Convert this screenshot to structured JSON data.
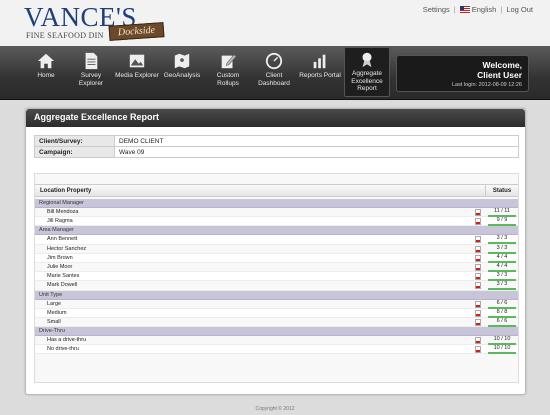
{
  "header": {
    "logo": {
      "main": "VANCE'S",
      "sub": "FINE SEAFOOD DIN",
      "badge": "Dockside"
    },
    "links": {
      "settings": "Settings",
      "language": "English",
      "logout": "Log Out"
    }
  },
  "nav": {
    "items": [
      {
        "label": "Home",
        "icon": "home-icon"
      },
      {
        "label": "Survey Explorer",
        "icon": "document-icon"
      },
      {
        "label": "Media Explorer",
        "icon": "image-icon"
      },
      {
        "label": "GeoAnalysis",
        "icon": "map-icon"
      },
      {
        "label": "Custom Rollups",
        "icon": "edit-icon"
      },
      {
        "label": "Client Dashboard",
        "icon": "gauge-icon"
      },
      {
        "label": "Reports Portal",
        "icon": "chart-icon"
      },
      {
        "label": "Aggregate Excellence Report",
        "icon": "award-icon"
      }
    ],
    "welcome": {
      "line1": "Welcome,",
      "line2": "Client User",
      "last_login": "Last login: 2012-08-09 12:26"
    }
  },
  "report": {
    "title": "Aggregate Excellence Report",
    "client_label": "Client/Survey:",
    "client_value": "DEMO CLIENT",
    "campaign_label": "Campaign:",
    "campaign_value": "Wave 09",
    "col_property": "Location Property",
    "col_status": "Status",
    "groups": [
      {
        "name": "Regional Manager",
        "rows": [
          {
            "name": "Bill Mendoza",
            "status": "11 / 11",
            "pct": 1
          },
          {
            "name": "Jill Ragma",
            "status": "9 / 9",
            "pct": 1
          }
        ]
      },
      {
        "name": "Area Manager",
        "rows": [
          {
            "name": "Ann Bennett",
            "status": "3 / 3",
            "pct": 1
          },
          {
            "name": "Hector Sanchez",
            "status": "3 / 3",
            "pct": 1
          },
          {
            "name": "Jim Brown",
            "status": "4 / 4",
            "pct": 1
          },
          {
            "name": "Julie Moor",
            "status": "4 / 4",
            "pct": 1
          },
          {
            "name": "Marie Santes",
            "status": "3 / 3",
            "pct": 1
          },
          {
            "name": "Mark Dowell",
            "status": "3 / 3",
            "pct": 1
          }
        ]
      },
      {
        "name": "Unit Type",
        "rows": [
          {
            "name": "Large",
            "status": "6 / 6",
            "pct": 1
          },
          {
            "name": "Medium",
            "status": "8 / 8",
            "pct": 1
          },
          {
            "name": "Small",
            "status": "6 / 6",
            "pct": 1
          }
        ]
      },
      {
        "name": "Drive-Thru",
        "rows": [
          {
            "name": "Has a drive-thru",
            "status": "10 / 10",
            "pct": 1
          },
          {
            "name": "No drive-thru",
            "status": "10 / 10",
            "pct": 1
          }
        ]
      }
    ]
  },
  "footer": {
    "copyright": "Copyright © 2012"
  },
  "colors": {
    "nav_bg": "#333333",
    "group_bg": "#c9c5d8",
    "status_bar": "#5cb85c",
    "logo_blue": "#1f3f7a"
  }
}
